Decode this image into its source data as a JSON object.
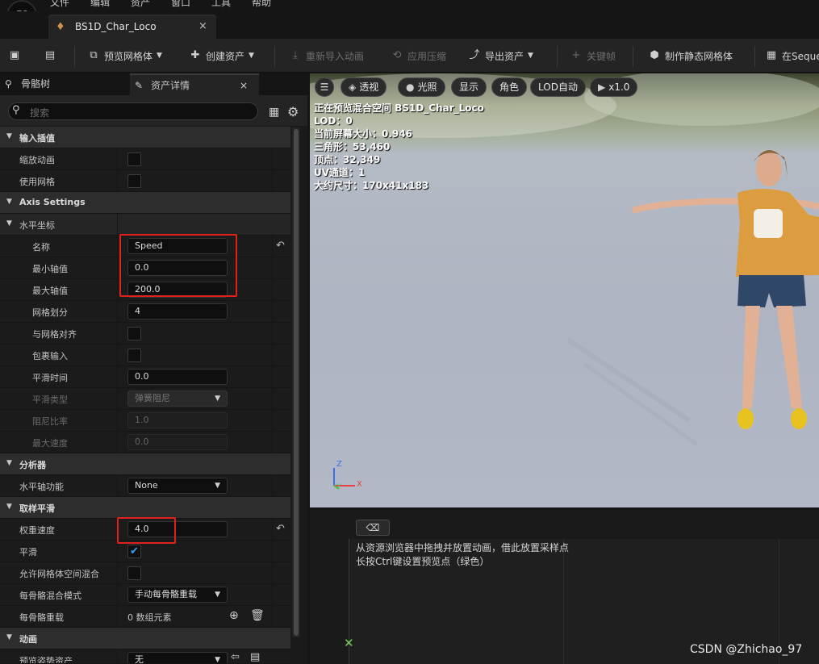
{
  "menu": [
    "文件",
    "编辑",
    "资产",
    "窗口",
    "工具",
    "帮助"
  ],
  "doc_tab": {
    "title": "BS1D_Char_Loco",
    "close": "×"
  },
  "toolbar": {
    "preview_mesh": "预览网格体",
    "create_asset": "创建资产",
    "reimport": "重新导入动画",
    "apply_compress": "应用压缩",
    "export_asset": "导出资产",
    "keyframe": "关键帧",
    "make_static_mesh": "制作静态网格体",
    "sequencer": "在Seque"
  },
  "panel_tabs": {
    "skeleton_tree": "骨骼树",
    "asset_details": "资产详情",
    "close": "×"
  },
  "search": {
    "placeholder": "搜索"
  },
  "rows": {
    "input_interp": "输入插值",
    "scale_anim": "缩放动画",
    "use_grid": "使用网格",
    "axis_settings": "Axis Settings",
    "horizontal_coord": "水平坐标",
    "name": "名称",
    "name_val": "Speed",
    "min_axis": "最小轴值",
    "min_val": "0.0",
    "max_axis": "最大轴值",
    "max_val": "200.0",
    "grid_div": "网格划分",
    "grid_val": "4",
    "snap_grid": "与网格对齐",
    "wrap_input": "包裹输入",
    "smooth_time": "平滑时间",
    "smooth_time_val": "0.0",
    "smooth_type": "平滑类型",
    "smooth_type_val": "弹簧阻尼",
    "damping": "阻尼比率",
    "damping_val": "1.0",
    "max_speed": "最大速度",
    "max_speed_val": "0.0",
    "analyzer": "分析器",
    "h_axis_func": "水平轴功能",
    "h_axis_func_val": "None",
    "sample_smooth": "取样平滑",
    "weight_speed": "权重速度",
    "weight_speed_val": "4.0",
    "smooth": "平滑",
    "allow_mesh_blend": "允许网格体空间混合",
    "per_bone_mode": "每骨骼混合模式",
    "per_bone_mode_val": "手动每骨骼重载",
    "per_bone_override": "每骨骼重载",
    "per_bone_override_val": "0 数组元素",
    "animation": "动画",
    "preview_pose": "预览姿势资产",
    "preview_pose_val": "无"
  },
  "viewport": {
    "buttons": {
      "perspective": "透视",
      "lighting": "光照",
      "show": "显示",
      "character": "角色",
      "lod": "LOD自动",
      "speed": "x1.0"
    },
    "stats": [
      "正在预览混合空间 BS1D_Char_Loco",
      "LOD：0",
      "当前屏幕大小：0.946",
      "三角形：53,460",
      "顶点：32,349",
      "UV通道：1",
      "大约尺寸：170x41x183"
    ],
    "axis": {
      "z": "Z",
      "x": "X",
      "y": "Y"
    }
  },
  "bottom": {
    "hint1": "从资源浏览器中拖拽并放置动画，借此放置采样点",
    "hint2": "长按Ctrl键设置预览点（绿色）"
  },
  "watermark": "CSDN @Zhichao_97"
}
